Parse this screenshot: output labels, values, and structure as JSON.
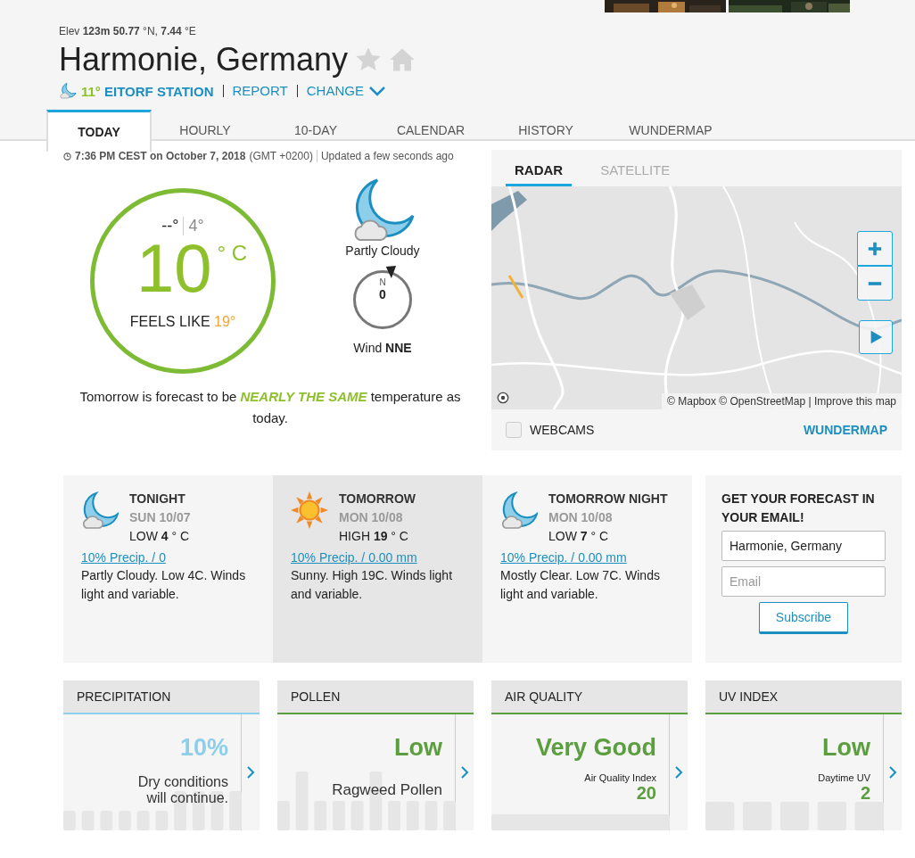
{
  "location": {
    "coords": "Elev **123m** **50.77** °N, **7.44** °E",
    "title": "Harmonie, Germany",
    "station_temp": "11°",
    "station": "EITORF STATION",
    "links": [
      "REPORT",
      "CHANGE"
    ]
  },
  "tabs": [
    {
      "label": "TODAY",
      "selected": true
    },
    {
      "label": "HOURLY",
      "selected": false
    },
    {
      "label": "10-DAY",
      "selected": false
    },
    {
      "label": "CALENDAR",
      "selected": false
    },
    {
      "label": "HISTORY",
      "selected": false
    },
    {
      "label": "WUNDERMAP",
      "selected": false
    }
  ],
  "observation": {
    "time": "7:36 PM CEST on October 7, 2018",
    "zone": "(GMT +0200)",
    "updated": "Updated a few seconds ago"
  },
  "current": {
    "high": "--°",
    "low": "4°",
    "temp": "10",
    "unit": "° C",
    "feels_label": "FEELS LIKE",
    "feels": "19°",
    "condition": "Partly Cloudy",
    "wind_speed": "0",
    "compass_n": "N",
    "wind": "Wind **NNE**"
  },
  "summary": {
    "before": "Tomorrow is forecast to be ",
    "highlight": "NEARLY THE SAME",
    "after": " temperature as today."
  },
  "map": {
    "tabs": [
      {
        "label": "RADAR",
        "selected": true
      },
      {
        "label": "SATELLITE",
        "selected": false
      }
    ],
    "attribution": "© Mapbox © OpenStreetMap | Improve this map",
    "webcams": {
      "label": "WEBCAMS",
      "checked": false
    },
    "link": "WUNDERMAP"
  },
  "forecast": [
    {
      "kind": "night",
      "period": "TONIGHT",
      "date": "SUN 10/07",
      "temp_label": "LOW",
      "temp": "4",
      "unit": "° C",
      "precip": "10% Precip. / 0",
      "text": "Partly Cloudy. Low 4C. Winds light and variable.",
      "selected": false
    },
    {
      "kind": "day",
      "period": "TOMORROW",
      "date": "MON 10/08",
      "temp_label": "HIGH",
      "temp": "19",
      "unit": "° C",
      "precip": "10% Precip. / 0.00 mm",
      "text": "Sunny. High 19C. Winds light and variable.",
      "selected": true
    },
    {
      "kind": "night",
      "period": "TOMORROW NIGHT",
      "date": "MON 10/08",
      "temp_label": "LOW",
      "temp": "7",
      "unit": "° C",
      "precip": "10% Precip. / 0.00 mm",
      "text": "Mostly Clear. Low 7C. Winds light and variable.",
      "selected": false
    }
  ],
  "email": {
    "title": "GET YOUR FORECAST IN YOUR EMAIL!",
    "location_value": "Harmonie, Germany",
    "email_placeholder": "Email",
    "button": "Subscribe"
  },
  "tiles": [
    {
      "kind": "precipitation",
      "title": "PRECIPITATION",
      "value": "10%",
      "color": "#8dcfea",
      "text": "Dry conditions will continue."
    },
    {
      "kind": "pollen",
      "title": "POLLEN",
      "value": "Low",
      "color": "#5a9e3e",
      "text": "Ragweed Pollen"
    },
    {
      "kind": "air",
      "title": "AIR QUALITY",
      "value": "Very Good",
      "color": "#5a9e3e",
      "label": "Air Quality Index",
      "number": "20"
    },
    {
      "kind": "uv",
      "title": "UV INDEX",
      "value": "Low",
      "color": "#5a9e3e",
      "label": "Daytime UV",
      "number": "2"
    }
  ]
}
